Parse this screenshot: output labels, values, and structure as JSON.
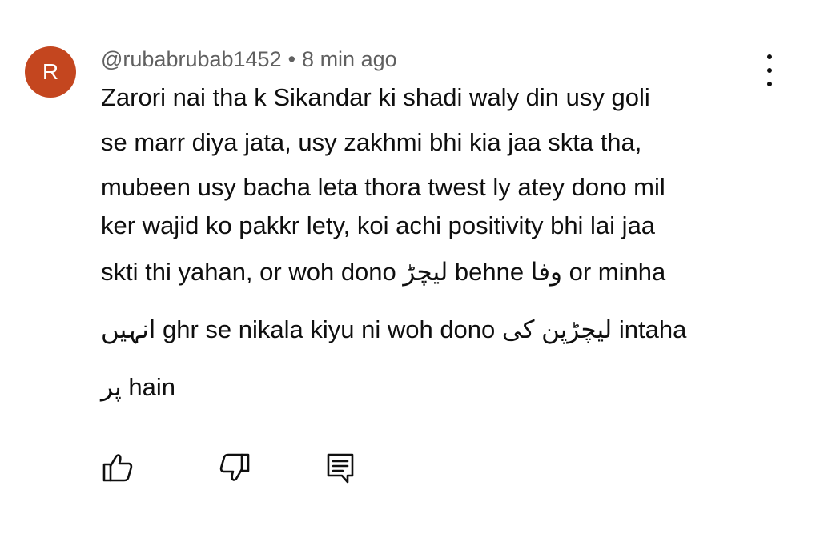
{
  "comment": {
    "avatar_letter": "R",
    "avatar_color": "#c4461f",
    "username": "@rubabrubab1452",
    "separator": "•",
    "timestamp": "8 min ago",
    "lines": [
      "Zarori nai tha k Sikandar ki shadi waly din usy goli",
      "se marr diya jata, usy zakhmi bhi kia jaa skta tha,",
      "mubeen usy bacha leta thora twest ly atey dono  mil",
      "ker wajid ko pakkr lety, koi achi positivity bhi lai jaa",
      "skti thi yahan, or woh dono لیچڑ behne وفا or minha",
      "انہیں ghr se nikala kiyu ni woh dono لیچڑپن کی intaha",
      "پر hain"
    ]
  },
  "icons": {
    "more": "more-vertical-icon",
    "like": "thumbs-up-icon",
    "dislike": "thumbs-down-icon",
    "reply": "reply-comment-icon"
  }
}
